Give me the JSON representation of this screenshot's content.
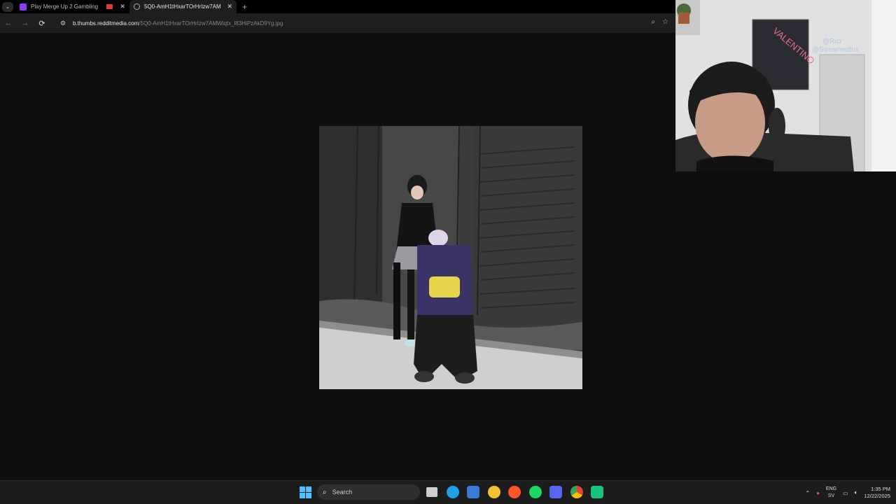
{
  "browser": {
    "tabs": [
      {
        "title": "Play Merge Up 2 Gambling",
        "favicon": "twitch-icon",
        "recording": true
      },
      {
        "title": "5Q0-AmH1tHxarTOrHrIzw7AM",
        "favicon": "globe-icon",
        "active": true
      }
    ],
    "tab_menu_icon": "chevron-down-icon",
    "new_tab_label": "+",
    "close_label": "✕",
    "url_host": "b.thumbs.redditmedia.com",
    "url_path": "/5Q0-AmH1tHxarTOrHrIzw7AMWiqtx_l83HiPzAkD9Yg.jpg",
    "nav": {
      "back": "←",
      "forward": "→",
      "reload": "⟳"
    }
  },
  "webcam_overlay": {
    "neon_sign_text": "VALENTINO",
    "watermark_lines": [
      "@Ricr",
      "@Streamedfus"
    ]
  },
  "taskbar": {
    "search_placeholder": "Search",
    "language_top": "ENG",
    "language_bottom": "SV",
    "time": "1:35 PM",
    "date": "12/22/2025",
    "colors": {
      "start": "#4cc2ff",
      "edge": "#1fa0e6",
      "spotify": "#1ed760",
      "brave": "#fb542b",
      "chrome": "#34a853"
    }
  }
}
